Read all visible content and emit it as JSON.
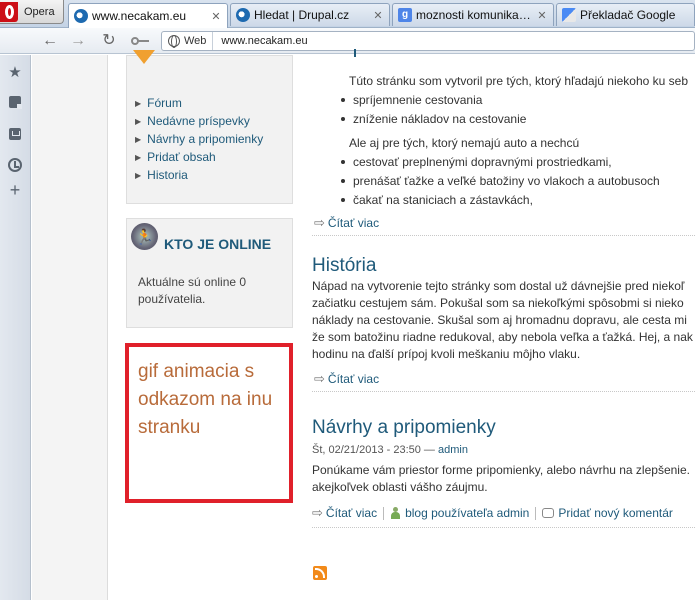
{
  "browser": {
    "menu_label": "Opera",
    "tabs": [
      {
        "title": "www.necakam.eu",
        "icon": "drupal-icon"
      },
      {
        "title": "Hledat | Drupal.cz",
        "icon": "drupal-icon"
      },
      {
        "title": "moznosti komunikacie ...",
        "icon": "google-icon"
      },
      {
        "title": "Překladač Google",
        "icon": "google-translate-icon"
      }
    ],
    "google_letter": "g",
    "address": {
      "badge": "Web",
      "url": "www.necakam.eu"
    }
  },
  "sidebar_nav": {
    "items": [
      "Fórum",
      "Nedávne príspevky",
      "Návrhy a pripomienky",
      "Pridať obsah",
      "Historia"
    ]
  },
  "who_online": {
    "title": "KTO JE ONLINE",
    "text": "Aktuálne sú online 0 používatelia."
  },
  "annotation": {
    "text": "gif animacia s odkazom na inu stranku"
  },
  "article1": {
    "intro": "Túto stránku som vytvoril pre tých, ktorý hľadajú niekoho ku seb",
    "bullets1": [
      "spríjemnenie cestovania",
      "zníženie nákladov na cestovanie"
    ],
    "intro2": "Ale aj pre tých, ktorý nemajú auto a nechcú",
    "bullets2": [
      "cestovať preplnenými dopravnými prostriedkami,",
      "prenášať ťažke a veľké batožiny vo vlakoch a autobusoch",
      "čakať na staniciach a zástavkách,"
    ],
    "read_more": "Čítať viac"
  },
  "article2": {
    "title": "História",
    "body": [
      "Nápad na vytvorenie tejto stránky som dostal už dávnejšie pred niekoľ",
      "začiatku cestujem sám. Pokušal som sa niekoľkými spôsobmi si nieko",
      "náklady na cestovanie. Skušal som aj hromadnu dopravu, ale cesta mi",
      "že som batožinu riadne redukoval, aby nebola veľka a ťažká. Hej, a nak",
      "hodinu na ďalší prípoj kvoli meškaniu môjho vlaku."
    ],
    "read_more": "Čítať viac"
  },
  "article3": {
    "title": "Návrhy a pripomienky",
    "date": "Št, 02/21/2013 - 23:50 —",
    "author": "admin",
    "body": [
      "Ponúkame vám priestor forme pripomienky, alebo návrhu na zlepšenie.",
      "akejkoľvek oblasti vášho záujmu."
    ],
    "read_more": "Čítať viac",
    "blog_link": "blog používateľa admin",
    "comment_link": "Pridať nový komentár"
  }
}
